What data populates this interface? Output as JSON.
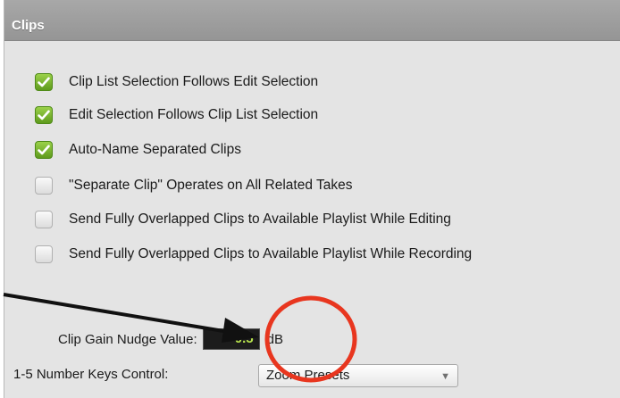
{
  "panel": {
    "title": "Clips"
  },
  "options": [
    {
      "label": "Clip List Selection Follows Edit Selection",
      "checked": true
    },
    {
      "label": "Edit Selection Follows Clip List Selection",
      "checked": true
    },
    {
      "label": "Auto-Name Separated Clips",
      "checked": true
    },
    {
      "label": "\"Separate Clip\" Operates on All Related Takes",
      "checked": false
    },
    {
      "label": "Send Fully Overlapped Clips to Available Playlist While Editing",
      "checked": false
    },
    {
      "label": "Send Fully Overlapped Clips to Available Playlist While Recording",
      "checked": false
    }
  ],
  "gain_nudge": {
    "label": "Clip Gain Nudge Value:",
    "value": "0.5",
    "unit": "dB"
  },
  "number_keys": {
    "label": "1-5 Number Keys Control:",
    "selected": "Zoom Presets"
  },
  "colors": {
    "checkbox_on": "#6fae2a",
    "field_value_text": "#b6e24d",
    "annotation_circle": "#e8361f",
    "annotation_arrow": "#111111"
  }
}
